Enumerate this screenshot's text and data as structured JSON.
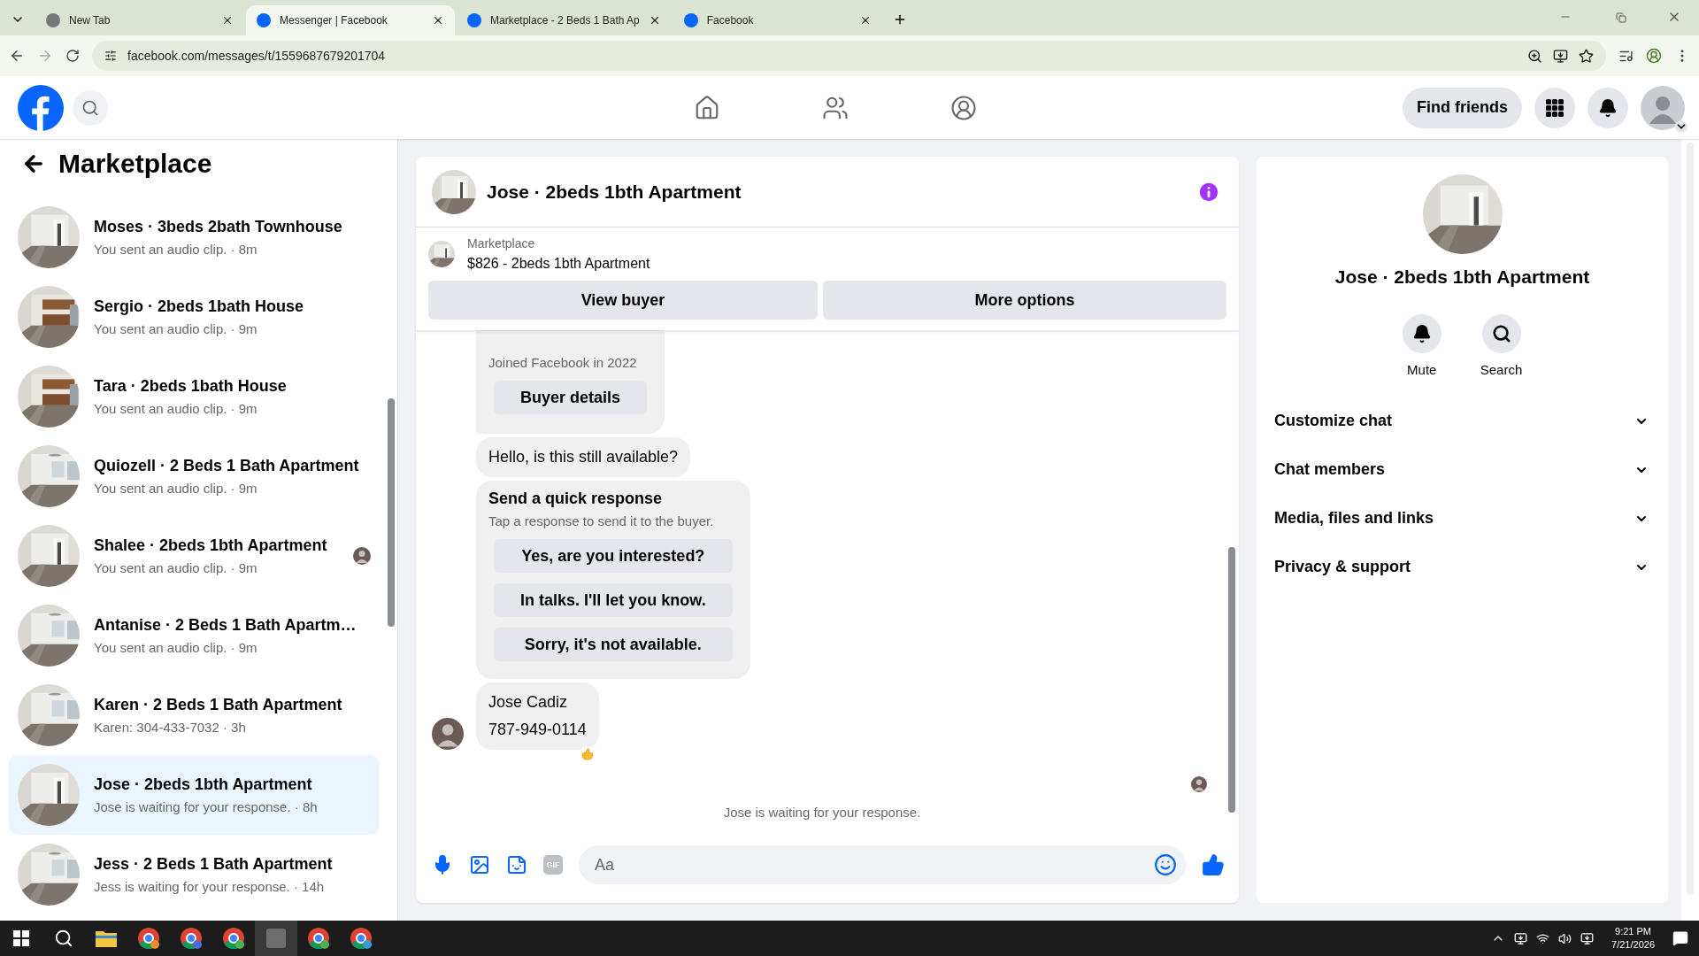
{
  "browser": {
    "tabs": [
      {
        "title": "New Tab",
        "selected": false
      },
      {
        "title": "Messenger | Facebook",
        "selected": true
      },
      {
        "title": "Marketplace - 2 Beds 1 Bath Ap",
        "selected": false
      },
      {
        "title": "Facebook",
        "selected": false
      }
    ],
    "url": "facebook.com/messages/t/1559687679201704"
  },
  "header": {
    "find_friends": "Find friends"
  },
  "sidebar": {
    "title": "Marketplace",
    "conversations": [
      {
        "title": "Moses · 3beds 2bath Townhouse",
        "preview": "You sent an audio clip. · 8m",
        "seen": false,
        "selected": false
      },
      {
        "title": "Sergio · 2beds 1bath House",
        "preview": "You sent an audio clip. · 9m",
        "seen": false,
        "selected": false
      },
      {
        "title": "Tara · 2beds 1bath House",
        "preview": "You sent an audio clip. · 9m",
        "seen": false,
        "selected": false
      },
      {
        "title": "Quiozell · 2 Beds 1 Bath Apartment",
        "preview": "You sent an audio clip. · 9m",
        "seen": false,
        "selected": false
      },
      {
        "title": "Shalee · 2beds 1bth Apartment",
        "preview": "You sent an audio clip. · 9m",
        "seen": true,
        "selected": false
      },
      {
        "title": "Antanise · 2 Beds 1 Bath Apartm…",
        "preview": "You sent an audio clip. · 9m",
        "seen": false,
        "selected": false
      },
      {
        "title": "Karen · 2 Beds 1 Bath Apartment",
        "preview": "Karen: 304-433-7032 · 3h",
        "seen": false,
        "selected": false
      },
      {
        "title": "Jose · 2beds 1bth Apartment",
        "preview": "Jose is waiting for your response. · 8h",
        "seen": false,
        "selected": true
      },
      {
        "title": "Jess · 2 Beds 1 Bath Apartment",
        "preview": "Jess is waiting for your response. · 14h",
        "seen": false,
        "selected": false
      }
    ]
  },
  "chat": {
    "title": "Jose · 2beds 1bth Apartment",
    "listing": {
      "label": "Marketplace",
      "text": "$826 - 2beds 1bth Apartment"
    },
    "actions": [
      "View buyer",
      "More options"
    ],
    "messages": [
      {
        "kind": "profile",
        "subtitle": "Joined Facebook in 2022",
        "button": "Buyer details"
      },
      {
        "kind": "text",
        "lines": [
          "Hello, is this still available?"
        ],
        "avatar": false,
        "reacted": false
      },
      {
        "kind": "quick",
        "title": "Send a quick response",
        "subtitle": "Tap a response to send it to the buyer.",
        "options": [
          "Yes, are you interested?",
          "In talks. I'll let you know.",
          "Sorry, it's not available."
        ]
      },
      {
        "kind": "text",
        "lines": [
          "Jose Cadiz",
          "787-949-0114"
        ],
        "avatar": true,
        "reacted": true
      }
    ],
    "status": "Jose is waiting for your response.",
    "composer": {
      "placeholder": "Aa",
      "gif_label": "GIF"
    }
  },
  "details": {
    "name": "Jose · 2beds 1bth Apartment",
    "actions": [
      {
        "kind": "mute",
        "label": "Mute"
      },
      {
        "kind": "search",
        "label": "Search"
      }
    ],
    "sections": [
      "Customize chat",
      "Chat members",
      "Media, files and links",
      "Privacy & support"
    ]
  },
  "taskbar": {
    "time": "9:21 PM",
    "date": "7/21/2026"
  }
}
